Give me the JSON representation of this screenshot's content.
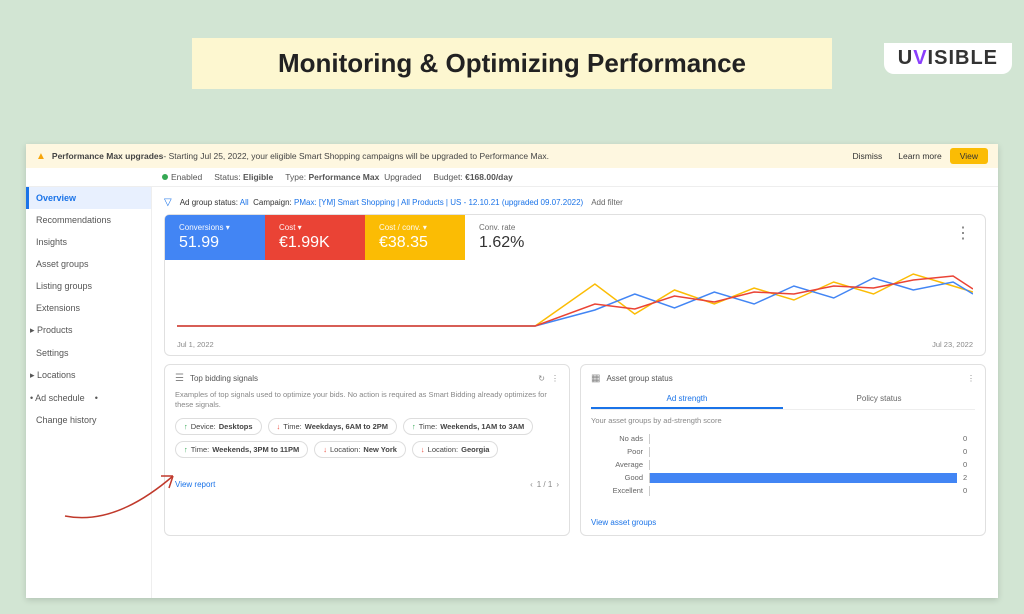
{
  "slide": {
    "title": "Monitoring & Optimizing Performance"
  },
  "logo": {
    "part1": "U",
    "part2": "V",
    "part3": "ISIBLE"
  },
  "alert": {
    "bold": "Performance Max upgrades",
    "text": " - Starting Jul 25, 2022, your eligible Smart Shopping campaigns will be upgraded to Performance Max.",
    "dismiss": "Dismiss",
    "learn": "Learn more",
    "view": "View"
  },
  "statusrow": {
    "enabled": "Enabled",
    "status_lbl": "Status:",
    "status_val": "Eligible",
    "type_lbl": "Type:",
    "type_val": "Performance Max",
    "type_extra": "Upgraded",
    "budget_lbl": "Budget:",
    "budget_val": "€168.00/day"
  },
  "sidebar": {
    "items": [
      "Overview",
      "Recommendations",
      "Insights",
      "Asset groups",
      "Listing groups",
      "Extensions",
      "Products",
      "Settings",
      "Locations",
      "Ad schedule",
      "Change history"
    ]
  },
  "filter": {
    "prefix": "Ad group status:",
    "all": "All",
    "camp_lbl": "Campaign:",
    "camp": "PMax: [YM] Smart Shopping | All Products | US - 12.10.21 (upgraded 09.07.2022)",
    "add": "Add filter"
  },
  "metrics": [
    {
      "label": "Conversions ▾",
      "value": "51.99"
    },
    {
      "label": "Cost ▾",
      "value": "€1.99K"
    },
    {
      "label": "Cost / conv. ▾",
      "value": "€38.35"
    },
    {
      "label": "Conv. rate",
      "value": "1.62%"
    }
  ],
  "chart": {
    "start": "Jul 1, 2022",
    "end": "Jul 23, 2022"
  },
  "bidding": {
    "title": "Top bidding signals",
    "desc": "Examples of top signals used to optimize your bids. No action is required as Smart Bidding already optimizes for these signals.",
    "chips": [
      {
        "dir": "up",
        "k": "Device:",
        "v": "Desktops"
      },
      {
        "dir": "down",
        "k": "Time:",
        "v": "Weekdays, 6AM to 2PM"
      },
      {
        "dir": "up",
        "k": "Time:",
        "v": "Weekends, 1AM to 3AM"
      },
      {
        "dir": "up",
        "k": "Time:",
        "v": "Weekends, 3PM to 11PM"
      },
      {
        "dir": "down",
        "k": "Location:",
        "v": "New York"
      },
      {
        "dir": "down",
        "k": "Location:",
        "v": "Georgia"
      }
    ],
    "view": "View report",
    "pager": "1 / 1"
  },
  "asset": {
    "title": "Asset group status",
    "tab1": "Ad strength",
    "tab2": "Policy status",
    "sub": "Your asset groups by ad-strength score",
    "rows": [
      {
        "label": "No ads",
        "value": 0
      },
      {
        "label": "Poor",
        "value": 0
      },
      {
        "label": "Average",
        "value": 0
      },
      {
        "label": "Good",
        "value": 2
      },
      {
        "label": "Excellent",
        "value": 0
      }
    ],
    "view": "View asset groups"
  },
  "chart_data": {
    "type": "line",
    "title": "",
    "xlabel": "",
    "ylabel": "",
    "x_range": [
      "Jul 1, 2022",
      "Jul 23, 2022"
    ],
    "series": [
      {
        "name": "Conversions",
        "color": "#4285f4"
      },
      {
        "name": "Cost",
        "color": "#ea4335"
      },
      {
        "name": "Cost / conv.",
        "color": "#fbbc04"
      }
    ]
  }
}
